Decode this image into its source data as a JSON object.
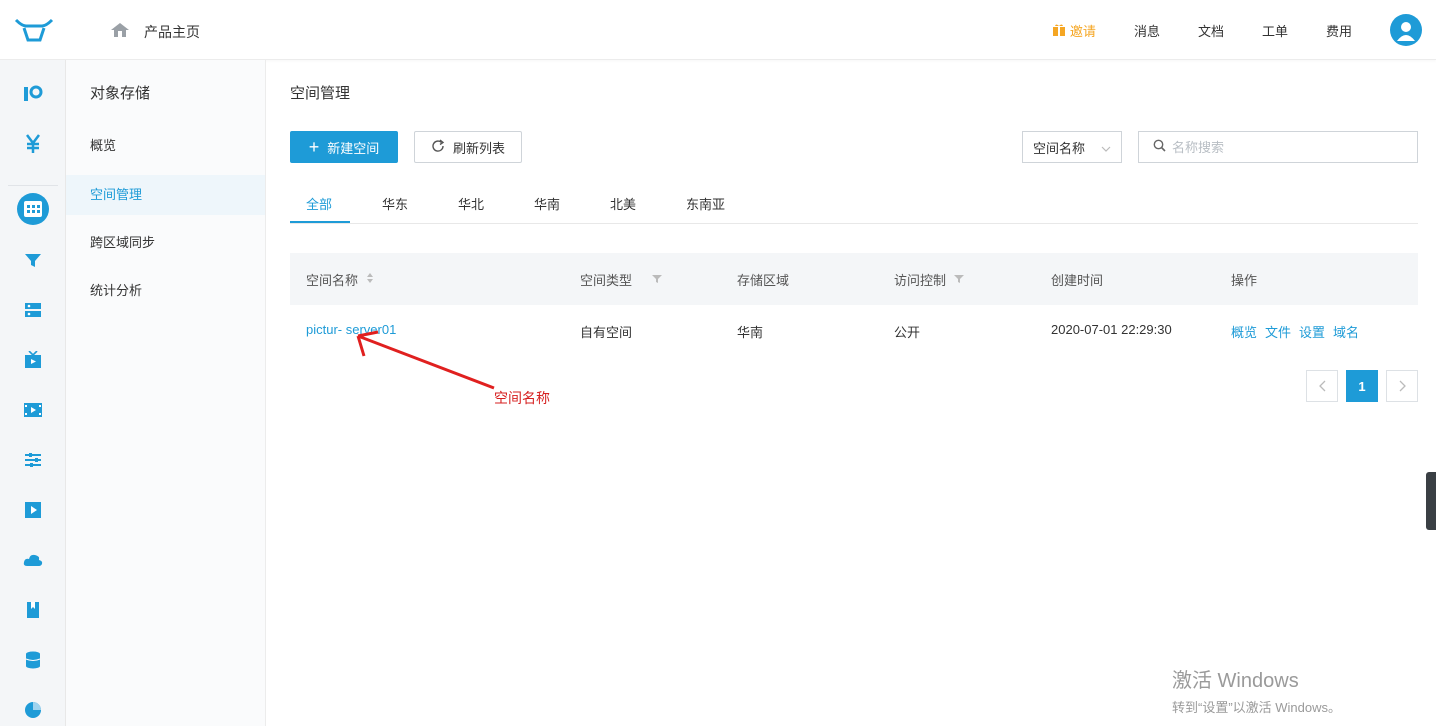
{
  "topbar": {
    "home_label": "产品主页",
    "invite_label": "邀请",
    "nav": [
      "消息",
      "文档",
      "工单",
      "费用"
    ],
    "accent": "#1e9bd7",
    "invite_color": "#f5a623"
  },
  "rail": {
    "icons": [
      "product-logo-icon",
      "billing-yuan-icon",
      "object-storage-icon",
      "cdn-funnel-icon",
      "server-icon",
      "live-tv-icon",
      "video-icon",
      "settings-sliders-icon",
      "media-play-icon",
      "cloud-mail-icon",
      "bookmark-icon",
      "database-icon",
      "chart-pie-icon"
    ]
  },
  "sidebar": {
    "title": "对象存储",
    "items": [
      {
        "label": "概览",
        "active": false
      },
      {
        "label": "空间管理",
        "active": true
      },
      {
        "label": "跨区域同步",
        "active": false
      },
      {
        "label": "统计分析",
        "active": false
      }
    ]
  },
  "main": {
    "title": "空间管理",
    "new_button": "新建空间",
    "refresh_button": "刷新列表",
    "filter_select": "空间名称",
    "search_placeholder": "名称搜索",
    "tabs": [
      "全部",
      "华东",
      "华北",
      "华南",
      "北美",
      "东南亚"
    ],
    "active_tab": "全部",
    "table": {
      "headers": [
        "空间名称",
        "空间类型",
        "存储区域",
        "访问控制",
        "创建时间",
        "操作"
      ],
      "rows": [
        {
          "name": "pictur- server01",
          "type": "自有空间",
          "region": "华南",
          "access": "公开",
          "created": "2020-07-01 22:29:30",
          "ops": [
            "概览",
            "文件",
            "设置",
            "域名"
          ]
        }
      ]
    },
    "pagination": {
      "current": "1"
    }
  },
  "annotation": {
    "text": "空间名称",
    "color": "#d61f1f"
  },
  "watermark": {
    "line1": "激活 Windows",
    "line2": "转到“设置”以激活 Windows。"
  }
}
